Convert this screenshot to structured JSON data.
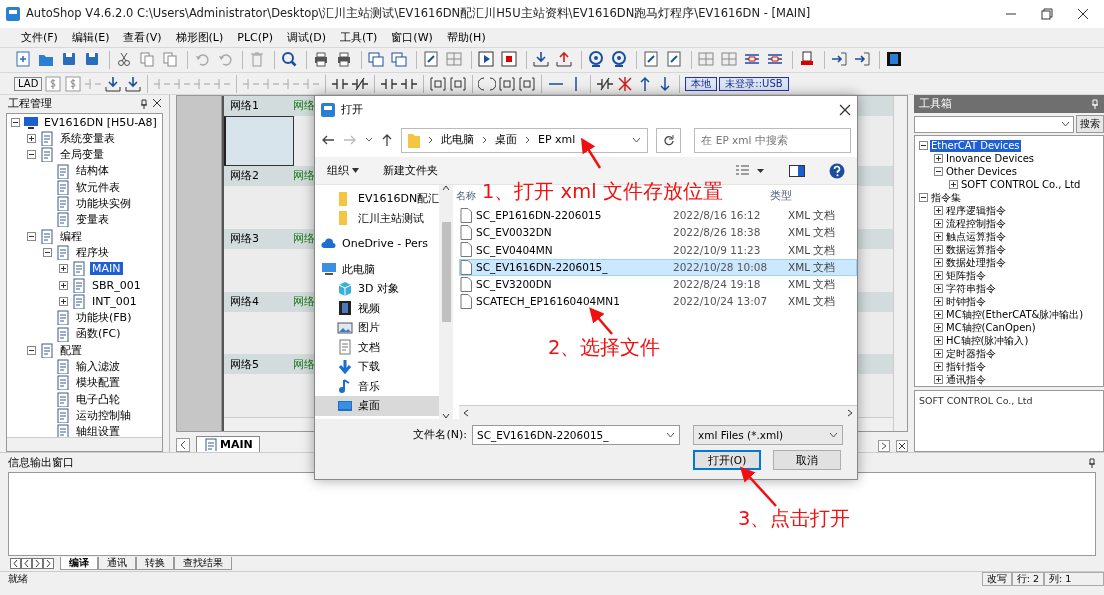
{
  "window": {
    "title": "AutoShop V4.6.2.0  C:\\Users\\Administrator\\Desktop\\汇川主站测试\\EV1616DN配汇川H5U主站资料\\EV1616DN跑马灯程序\\EV1616DN - [MAIN]"
  },
  "menu": [
    "文件(F)",
    "编辑(E)",
    "查看(V)",
    "梯形图(L)",
    "PLC(P)",
    "调试(D)",
    "工具(T)",
    "窗口(W)",
    "帮助(H)"
  ],
  "toolbar_labels": {
    "lad": "LAD",
    "local": "本地",
    "login": "未登录::USB"
  },
  "project_panel": {
    "title": "工程管理",
    "items": [
      {
        "label": "EV1616DN [H5U-A8]",
        "expanded": true,
        "selected": false,
        "children": [
          {
            "label": "系统变量表",
            "expanded": false,
            "selected": false
          },
          {
            "label": "全局变量",
            "expanded": true,
            "selected": false,
            "children": [
              {
                "label": "结构体",
                "selected": false
              },
              {
                "label": "软元件表",
                "selected": false
              },
              {
                "label": "功能块实例",
                "selected": false
              },
              {
                "label": "变量表",
                "selected": false
              }
            ]
          },
          {
            "label": "编程",
            "expanded": true,
            "selected": false,
            "children": [
              {
                "label": "程序块",
                "expanded": true,
                "selected": false,
                "children": [
                  {
                    "label": "MAIN",
                    "expanded": false,
                    "selected": true
                  },
                  {
                    "label": "SBR_001",
                    "expanded": false,
                    "selected": false
                  },
                  {
                    "label": "INT_001",
                    "expanded": false,
                    "selected": false
                  }
                ]
              },
              {
                "label": "功能块(FB)",
                "selected": false
              },
              {
                "label": "函数(FC)",
                "selected": false
              }
            ]
          },
          {
            "label": "配置",
            "expanded": true,
            "selected": false,
            "children": [
              {
                "label": "输入滤波",
                "selected": false
              },
              {
                "label": "模块配置",
                "selected": false
              },
              {
                "label": "电子凸轮",
                "selected": false
              },
              {
                "label": "运动控制轴",
                "selected": false
              },
              {
                "label": "轴组设置",
                "selected": false
              }
            ]
          }
        ]
      }
    ]
  },
  "editor": {
    "networks": [
      {
        "label": "网络1",
        "comment": "网络"
      },
      {
        "label": "网络2",
        "comment": "网络"
      },
      {
        "label": "网络3",
        "comment": "网络"
      },
      {
        "label": "网络4",
        "comment": "网络"
      },
      {
        "label": "网络5",
        "comment": "网络"
      }
    ],
    "tab": "MAIN"
  },
  "toolbox": {
    "title": "工具箱",
    "search_button": "搜索",
    "items": [
      {
        "label": "EtherCAT Devices",
        "expanded": true,
        "selected": true,
        "children": [
          {
            "label": "Inovance Devices",
            "expanded": false,
            "selected": false
          },
          {
            "label": "Other Devices",
            "expanded": true,
            "selected": false,
            "children": [
              {
                "label": "SOFT CONTROL Co., Ltd",
                "expanded": false,
                "selected": false
              }
            ]
          }
        ]
      },
      {
        "label": "指令集",
        "expanded": true,
        "selected": false,
        "children": [
          {
            "label": "程序逻辑指令",
            "expanded": false,
            "selected": false
          },
          {
            "label": "流程控制指令",
            "expanded": false,
            "selected": false
          },
          {
            "label": "触点运算指令",
            "expanded": false,
            "selected": false
          },
          {
            "label": "数据运算指令",
            "expanded": false,
            "selected": false
          },
          {
            "label": "数据处理指令",
            "expanded": false,
            "selected": false
          },
          {
            "label": "矩阵指令",
            "expanded": false,
            "selected": false
          },
          {
            "label": "字符串指令",
            "expanded": false,
            "selected": false
          },
          {
            "label": "时钟指令",
            "expanded": false,
            "selected": false
          },
          {
            "label": "MC轴控(EtherCAT&脉冲输出)",
            "expanded": false,
            "selected": false
          },
          {
            "label": "MC轴控(CanOpen)",
            "expanded": false,
            "selected": false
          },
          {
            "label": "HC轴控(脉冲输入)",
            "expanded": false,
            "selected": false
          },
          {
            "label": "定时器指令",
            "expanded": false,
            "selected": false
          },
          {
            "label": "指针指令",
            "expanded": false,
            "selected": false
          },
          {
            "label": "通讯指令",
            "expanded": false,
            "selected": false
          }
        ]
      }
    ],
    "description": "SOFT CONTROL Co., Ltd"
  },
  "output": {
    "title": "信息输出窗口",
    "tabs": [
      {
        "label": "编译",
        "selected": true
      },
      {
        "label": "通讯",
        "selected": false
      },
      {
        "label": "转换",
        "selected": false
      },
      {
        "label": "查找结果",
        "selected": false
      }
    ]
  },
  "status_bar": {
    "text": "就绪",
    "mode": "改写",
    "row": "行:  2",
    "col": "列:  1"
  },
  "dialog": {
    "title": "打开",
    "path": [
      "此电脑",
      "桌面",
      "EP xml"
    ],
    "search_placeholder": "在 EP xml 中搜索",
    "organize": "组织",
    "new_folder": "新建文件夹",
    "nav": [
      {
        "label": "EV1616DN配汇",
        "kind": "folder",
        "selected": false
      },
      {
        "label": "汇川主站测试",
        "kind": "folder",
        "selected": false
      },
      {
        "label": "OneDrive - Pers",
        "kind": "cloud",
        "selected": false
      },
      {
        "label": "此电脑",
        "kind": "computer",
        "selected": false
      },
      {
        "label": "3D 对象",
        "kind": "cube",
        "selected": false
      },
      {
        "label": "视频",
        "kind": "film",
        "selected": false
      },
      {
        "label": "图片",
        "kind": "image",
        "selected": false
      },
      {
        "label": "文档",
        "kind": "document",
        "selected": false
      },
      {
        "label": "下载",
        "kind": "download",
        "selected": false
      },
      {
        "label": "音乐",
        "kind": "music",
        "selected": false
      },
      {
        "label": "桌面",
        "kind": "desktop",
        "selected": true
      }
    ],
    "columns": {
      "name": "名称",
      "type": "类型"
    },
    "files": [
      {
        "name": "SC_EP1616DN-2206015",
        "date": "2022/8/16 16:12",
        "type": "XML 文档",
        "selected": false
      },
      {
        "name": "SC_EV0032DN",
        "date": "2022/8/26 18:38",
        "type": "XML 文档",
        "selected": false
      },
      {
        "name": "SC_EV0404MN",
        "date": "2022/10/9 11:23",
        "type": "XML 文档",
        "selected": false
      },
      {
        "name": "SC_EV1616DN-2206015_",
        "date": "2022/10/28 10:08",
        "type": "XML 文档",
        "selected": true
      },
      {
        "name": "SC_EV3200DN",
        "date": "2022/8/24 19:18",
        "type": "XML 文档",
        "selected": false
      },
      {
        "name": "SCATECH_EP16160404MN1",
        "date": "2022/10/24 13:07",
        "type": "XML 文档",
        "selected": false
      }
    ],
    "filename_label": "文件名(N):",
    "filename": "SC_EV1616DN-2206015_",
    "filter": "xml Files (*.xml)",
    "open": "打开(O)",
    "cancel": "取消"
  },
  "annotations": [
    "1、打开 xml 文件存放位置",
    "2、选择文件",
    "3、点击打开"
  ]
}
